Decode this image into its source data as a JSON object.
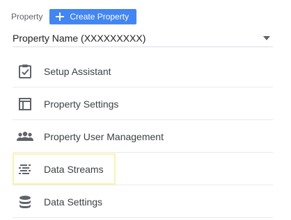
{
  "header": {
    "property_label": "Property",
    "create_button_label": "Create Property"
  },
  "property_select": {
    "value": "Property Name (XXXXXXXXX)"
  },
  "menu": {
    "items": [
      {
        "label": "Setup Assistant",
        "icon": "clipboard-check-icon"
      },
      {
        "label": "Property Settings",
        "icon": "layout-panel-icon"
      },
      {
        "label": "Property User Management",
        "icon": "people-icon"
      },
      {
        "label": "Data Streams",
        "icon": "data-streams-icon",
        "highlighted": true
      },
      {
        "label": "Data Settings",
        "icon": "database-icon"
      }
    ]
  },
  "colors": {
    "primary_button": "#4285f4",
    "icon_gray": "#5f6368",
    "highlight_border": "#fbf3a8",
    "divider": "#e8eaed"
  }
}
